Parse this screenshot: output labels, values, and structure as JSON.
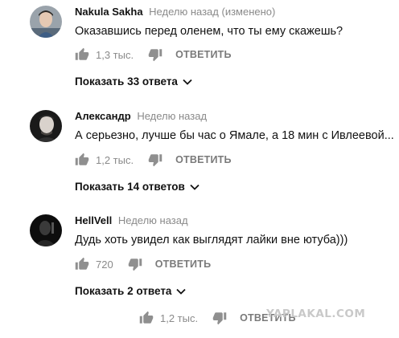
{
  "comments": [
    {
      "author": "Nakula Sakha",
      "time": "Неделю назад (изменено)",
      "text": "Оказавшись перед оленем, что ты ему скажешь?",
      "likes": "1,3 тыс.",
      "reply_label": "ОТВЕТИТЬ",
      "show_replies": "Показать 33 ответа",
      "avatar_icon": "avatar-young-man-icon"
    },
    {
      "author": "Александр",
      "time": "Неделю назад",
      "text": "А серьезно, лучше бы час о Ямале, а 18 мин с Ивлеевой...",
      "likes": "1,2 тыс.",
      "reply_label": "ОТВЕТИТЬ",
      "show_replies": "Показать 14 ответов",
      "avatar_icon": "avatar-man-portrait-icon"
    },
    {
      "author": "HellVell",
      "time": "Неделю назад",
      "text": "Дудь хоть увидел как выглядят лайки вне ютуба)))",
      "likes": "720",
      "reply_label": "ОТВЕТИТЬ",
      "show_replies": "Показать 2 ответа",
      "avatar_icon": "avatar-dark-silhouette-icon"
    }
  ],
  "bottom_actions": {
    "likes": "1,2 тыс.",
    "reply_label": "ОТВЕТИТЬ"
  },
  "watermark": "YAPLAKAL.COM",
  "icons": {
    "like": "thumb-up-icon",
    "dislike": "thumb-down-icon",
    "chevron": "chevron-down-icon"
  },
  "colors": {
    "icon": "#8f8f8f",
    "meta": "#8a8a8a",
    "text": "#111111",
    "watermark": "#c9c9c9"
  }
}
